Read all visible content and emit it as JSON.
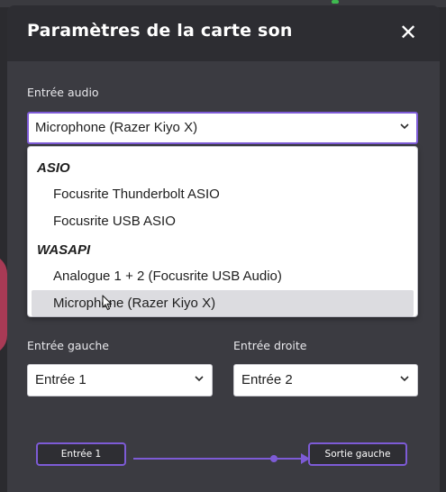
{
  "dialog": {
    "title": "Paramètres de la carte son",
    "close_glyph": "✕"
  },
  "audio_input": {
    "label": "Entrée audio",
    "selected": "Microphone (Razer Kiyo X)",
    "options": [
      {
        "group": "ASIO"
      },
      {
        "label": "Focusrite Thunderbolt ASIO"
      },
      {
        "label": "Focusrite USB ASIO"
      },
      {
        "group": "WASAPI"
      },
      {
        "label": "Analogue 1 + 2 (Focusrite USB Audio)"
      },
      {
        "label": "Microphone (Razer Kiyo X)",
        "selected": true
      }
    ]
  },
  "left_input": {
    "label": "Entrée gauche",
    "selected": "Entrée 1"
  },
  "right_input": {
    "label": "Entrée droite",
    "selected": "Entrée 2"
  },
  "routing": {
    "source": "Entrée 1",
    "destination": "Sortie gauche"
  },
  "colors": {
    "accent": "#7d5bd6",
    "dialog_bg": "#3b3b41",
    "header_bg": "#2d2d32"
  },
  "icons": [
    "close-icon",
    "chevron-down-icon",
    "mouse-pointer-icon",
    "arrow-right-icon"
  ]
}
